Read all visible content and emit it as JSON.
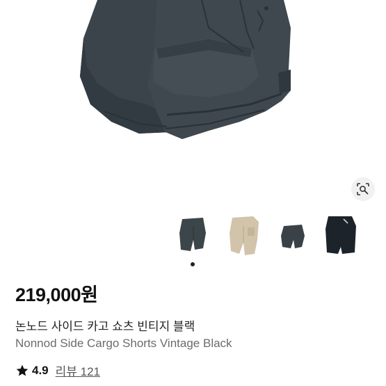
{
  "product": {
    "price": "219,000원",
    "title_ko": "논노드 사이드 카고 쇼츠 빈티지 블랙",
    "title_en": "Nonnod Side Cargo Shorts Vintage Black",
    "rating": "4.9",
    "review_link": "리뷰 121"
  },
  "gallery": {
    "thumbnails": [
      {
        "name": "thumb-dark-grey-shorts",
        "color": "#3c4549"
      },
      {
        "name": "thumb-beige-shorts",
        "color": "#d2c4aa"
      },
      {
        "name": "thumb-dark-grey-shorts-small",
        "color": "#3b4247"
      },
      {
        "name": "thumb-black-shorts",
        "color": "#1d232a"
      }
    ],
    "active_index": 0
  },
  "icons": {
    "lens": "image-search-icon",
    "star": "star-icon"
  },
  "colors": {
    "shorts_main": "#3b454b",
    "shorts_shadow": "#2a3237",
    "lens_bg": "#f1f1f1",
    "text_secondary": "#6b6b6b"
  }
}
